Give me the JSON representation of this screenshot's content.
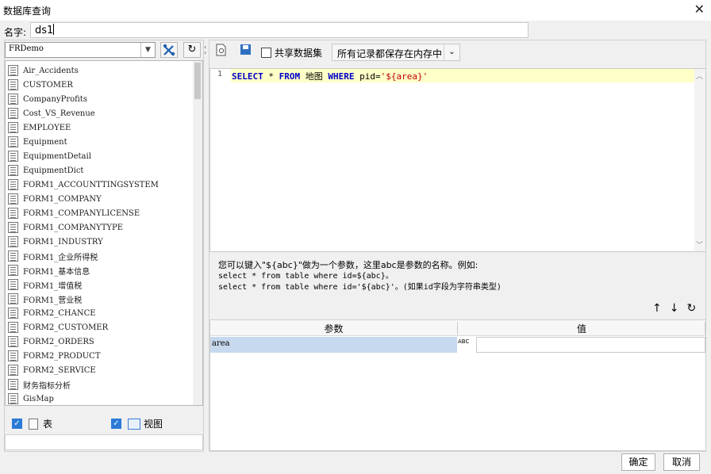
{
  "window": {
    "title": "数据库查询"
  },
  "name_field": {
    "label": "名字:",
    "value": "ds1"
  },
  "left": {
    "datasource": "FRDemo",
    "tables": [
      "Air_Accidents",
      "CUSTOMER",
      "CompanyProfits",
      "Cost_VS_Revenue",
      "EMPLOYEE",
      "Equipment",
      "EquipmentDetail",
      "EquipmentDict",
      "FORM1_ACCOUNTTINGSYSTEM",
      "FORM1_COMPANY",
      "FORM1_COMPANYLICENSE",
      "FORM1_COMPANYTYPE",
      "FORM1_INDUSTRY",
      "FORM1_企业所得税",
      "FORM1_基本信息",
      "FORM1_增值税",
      "FORM1_营业税",
      "FORM2_CHANCE",
      "FORM2_CUSTOMER",
      "FORM2_ORDERS",
      "FORM2_PRODUCT",
      "FORM2_SERVICE",
      "财务指标分析",
      "GisMap"
    ],
    "filter_table_label": "表",
    "filter_view_label": "视图"
  },
  "toolbar": {
    "share_label": "共享数据集",
    "memory_option": "所有记录都保存在内存中"
  },
  "editor": {
    "line_number": "1",
    "kw_select": "SELECT",
    "star": " * ",
    "kw_from": "FROM",
    "table": " 地图 ",
    "kw_where": "WHERE",
    "cond": " pid=",
    "param_str": "'${area}'"
  },
  "hint": {
    "line1": "您可以键入\"${abc}\"做为一个参数，这里abc是参数的名称。例如:",
    "line2": "select * from table where id=${abc}。",
    "line3": "select * from table where id='${abc}'。(如果id字段为字符串类型)"
  },
  "params": {
    "col_param": "参数",
    "col_value": "值",
    "rows": [
      {
        "name": "area",
        "type_icon": "ABC",
        "value": ""
      }
    ]
  },
  "footer": {
    "ok": "确定",
    "cancel": "取消"
  }
}
